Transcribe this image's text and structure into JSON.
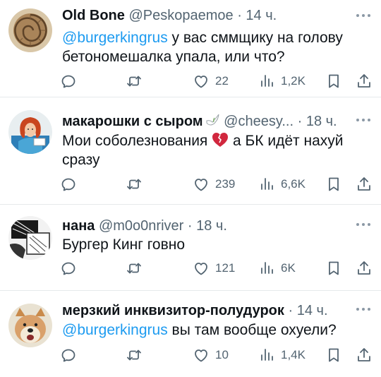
{
  "tweets": [
    {
      "name": "Old Bone",
      "handle": "@Peskopaemoe",
      "dot": "·",
      "time": "14 ч.",
      "mention": "@burgerkingrus",
      "text_line1": " у вас сммщику на голову",
      "text_line2": "бетономешалка упала, или что?",
      "likes": "22",
      "views": "1,2K",
      "avatar": "ammonite-fossil"
    },
    {
      "name": "макарошки с сыром",
      "handle": "@cheesy...",
      "dot": "·",
      "time": "18 ч.",
      "text_line1a": "Мои соболезнования",
      "text_line1b": "а БК идёт нахуй",
      "text_line2": "сразу",
      "likes": "239",
      "views": "6,6K",
      "avatar": "red-haired-character",
      "name_badge": "dove-emoji",
      "inline_emoji": "broken-heart-emoji"
    },
    {
      "name": "нана",
      "handle": "@m0o0nriver",
      "dot": "·",
      "time": "18 ч.",
      "text_line1": "Бургер Кинг говно",
      "likes": "121",
      "views": "6K",
      "avatar": "manga-sketch"
    },
    {
      "name": "мерзкий инквизитор-полудурок",
      "handle": "",
      "dot": "·",
      "time": "14 ч.",
      "mention": "@burgerkingrus",
      "text_line1": " вы там вообще охуели?",
      "likes": "10",
      "views": "1,4K",
      "avatar": "shiba-doge"
    }
  ],
  "icons": {
    "reply": "reply-icon",
    "retweet": "retweet-icon",
    "like": "heart-icon",
    "views": "views-icon",
    "bookmark": "bookmark-icon",
    "share": "share-icon",
    "more": "more-icon"
  },
  "colors": {
    "text": "#0f1419",
    "secondary": "#536471",
    "link": "#1d9bf0",
    "divider": "#e6e9eb"
  }
}
